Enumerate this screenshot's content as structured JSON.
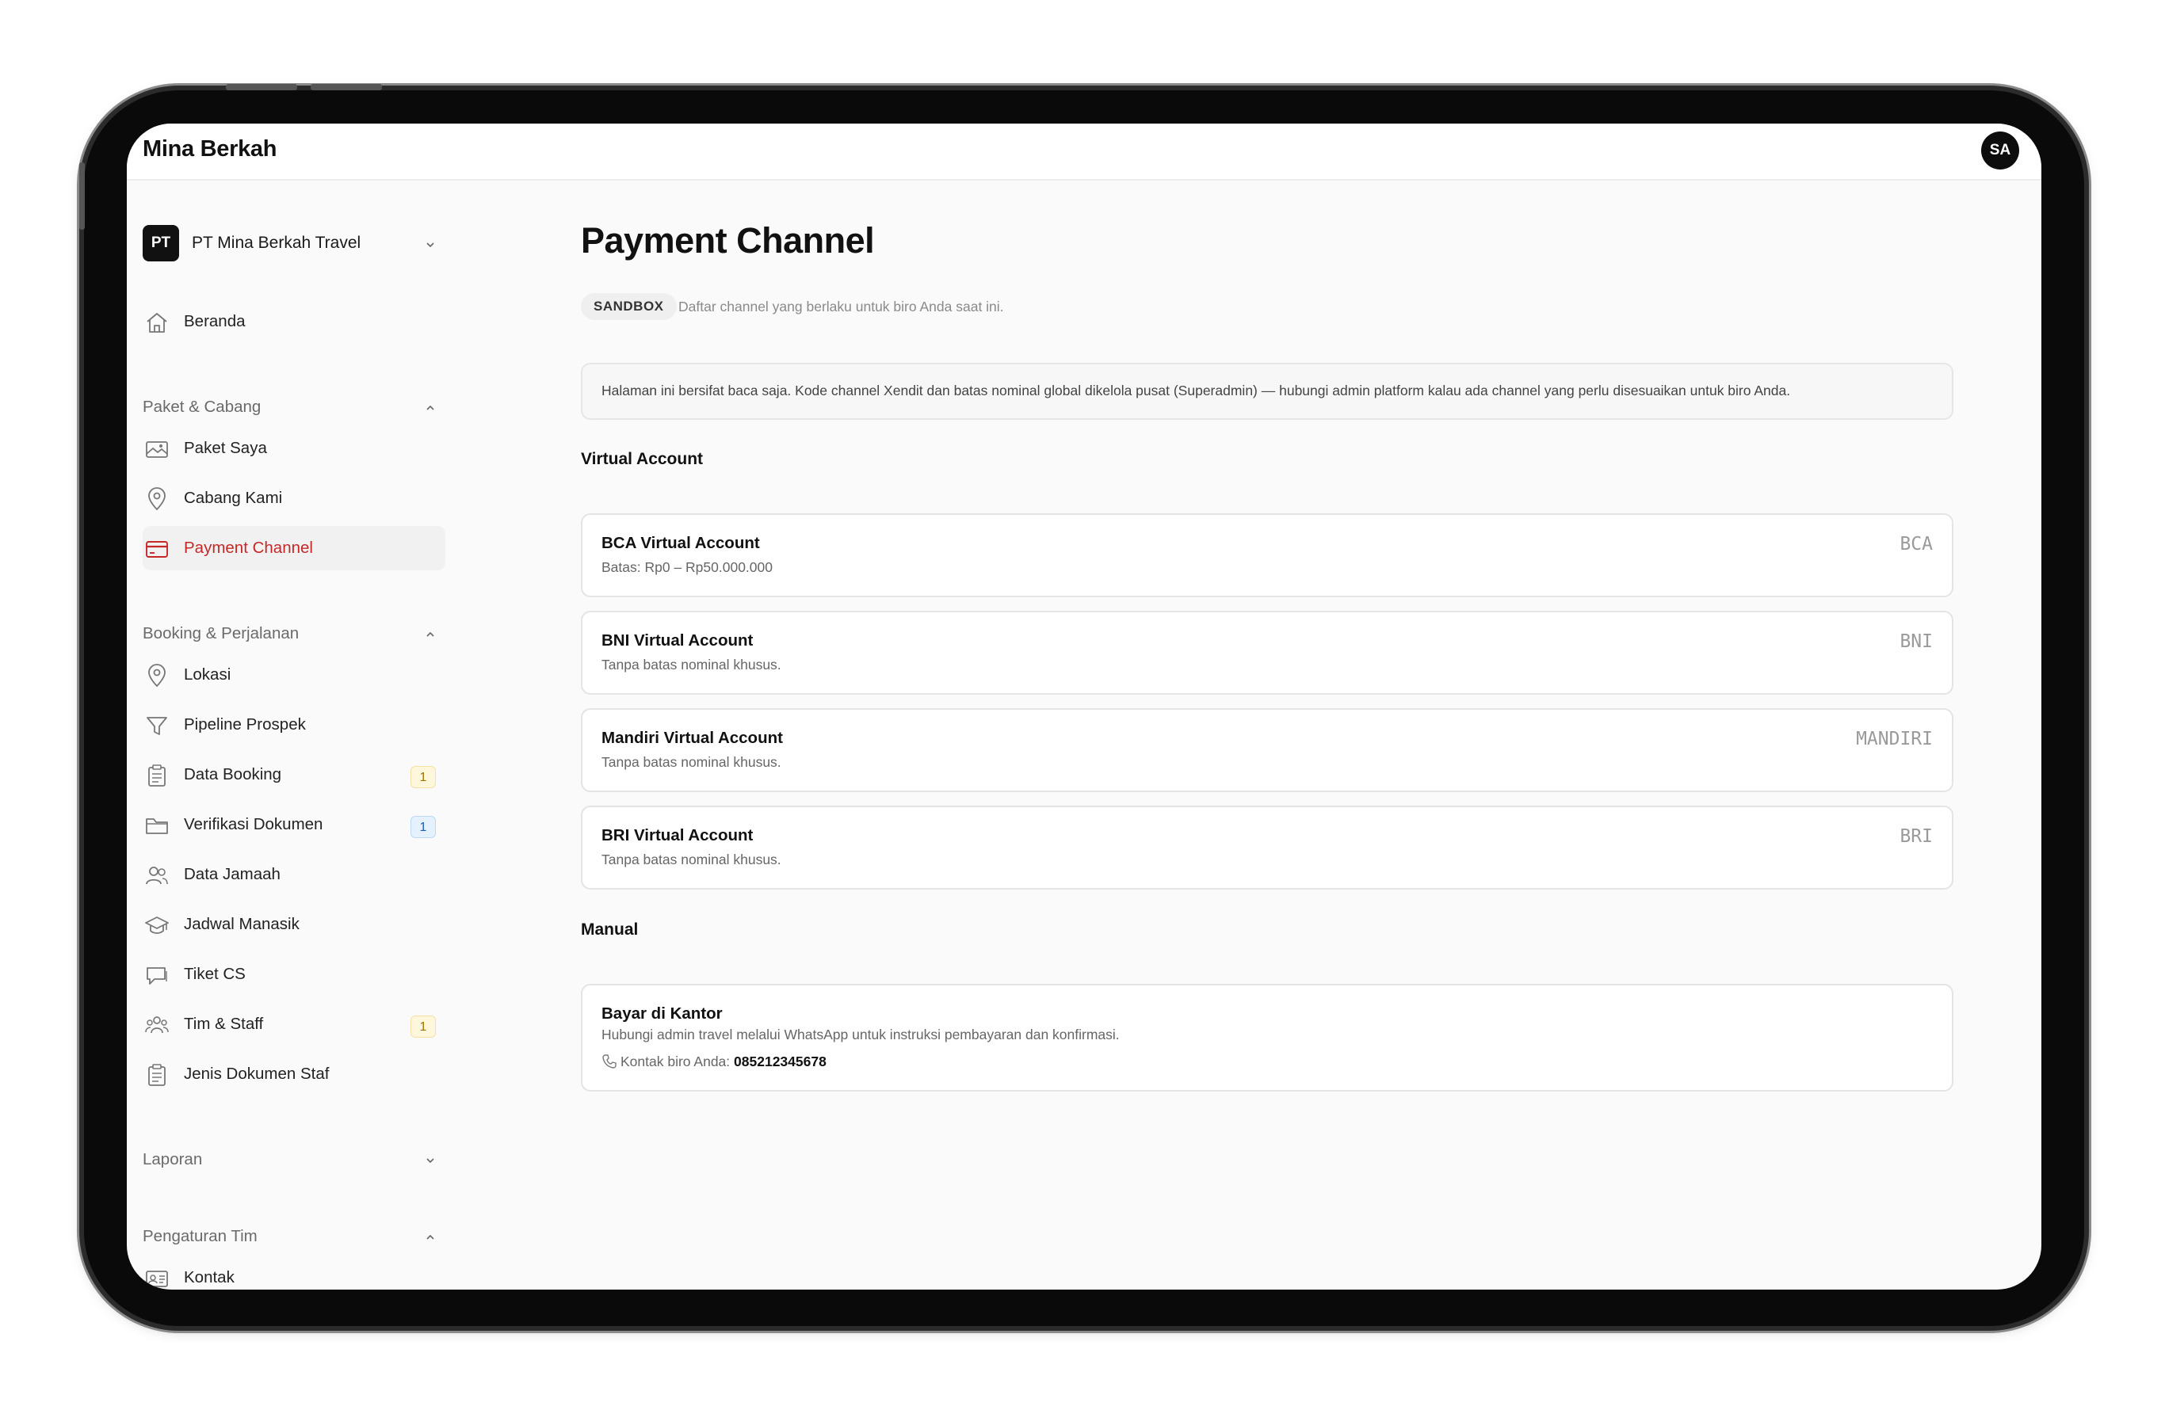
{
  "app": {
    "brand": "Mina Berkah",
    "user_initials": "SA"
  },
  "org": {
    "logo_text": "PT",
    "name": "PT Mina Berkah Travel"
  },
  "sidebar": {
    "home": {
      "label": "Beranda",
      "icon": "home-icon"
    },
    "sections": [
      {
        "title": "Paket & Cabang",
        "expanded": true,
        "items": [
          {
            "label": "Paket Saya",
            "icon": "image-icon"
          },
          {
            "label": "Cabang Kami",
            "icon": "map-pin-icon"
          },
          {
            "label": "Payment Channel",
            "icon": "credit-card-icon",
            "active": true
          }
        ]
      },
      {
        "title": "Booking & Perjalanan",
        "expanded": true,
        "items": [
          {
            "label": "Lokasi",
            "icon": "map-pin-icon"
          },
          {
            "label": "Pipeline Prospek",
            "icon": "filter-icon"
          },
          {
            "label": "Data Booking",
            "icon": "clipboard-icon",
            "badge": "1",
            "badge_color": "yellow"
          },
          {
            "label": "Verifikasi Dokumen",
            "icon": "folder-icon",
            "badge": "1",
            "badge_color": "blue"
          },
          {
            "label": "Data Jamaah",
            "icon": "users-icon"
          },
          {
            "label": "Jadwal Manasik",
            "icon": "graduation-cap-icon"
          },
          {
            "label": "Tiket CS",
            "icon": "chat-icon"
          },
          {
            "label": "Tim & Staff",
            "icon": "team-icon",
            "badge": "1",
            "badge_color": "yellow"
          },
          {
            "label": "Jenis Dokumen Staf",
            "icon": "clipboard-icon"
          }
        ]
      },
      {
        "title": "Laporan",
        "expanded": false,
        "items": []
      },
      {
        "title": "Pengaturan Tim",
        "expanded": true,
        "items": [
          {
            "label": "Kontak",
            "icon": "contact-card-icon"
          }
        ]
      }
    ]
  },
  "main": {
    "title": "Payment Channel",
    "env_badge": "SANDBOX",
    "subtitle": "Daftar channel yang berlaku untuk biro Anda saat ini.",
    "info": "Halaman ini bersifat baca saja. Kode channel Xendit dan batas nominal global dikelola pusat (Superadmin) — hubungi admin platform kalau ada channel yang perlu disesuaikan untuk biro Anda.",
    "va_group_title": "Virtual Account",
    "virtual_accounts": [
      {
        "name": "BCA Virtual Account",
        "limit": "Batas: Rp0 – Rp50.000.000",
        "code": "BCA"
      },
      {
        "name": "BNI Virtual Account",
        "limit": "Tanpa batas nominal khusus.",
        "code": "BNI"
      },
      {
        "name": "Mandiri Virtual Account",
        "limit": "Tanpa batas nominal khusus.",
        "code": "MANDIRI"
      },
      {
        "name": "BRI Virtual Account",
        "limit": "Tanpa batas nominal khusus.",
        "code": "BRI"
      }
    ],
    "manual_group_title": "Manual",
    "manual": {
      "name": "Bayar di Kantor",
      "description": "Hubungi admin travel melalui WhatsApp untuk instruksi pembayaran dan konfirmasi.",
      "contact_label": "Kontak biro Anda:",
      "contact_number": "085212345678"
    }
  },
  "colors": {
    "active": "#c62828",
    "badge_yellow": "#fff7dc",
    "badge_blue": "#e5f1ff"
  }
}
